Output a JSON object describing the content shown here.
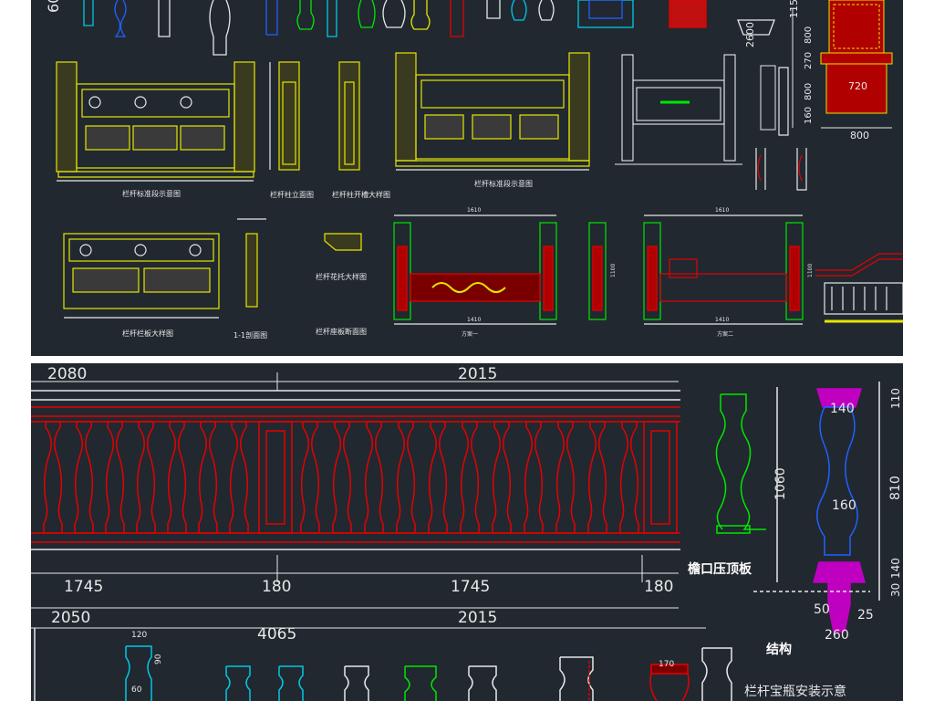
{
  "colors": {
    "background": "#212830",
    "page": "#ffffff",
    "yellow": "#e6e600",
    "red": "#e60000",
    "green": "#00e600",
    "cyan": "#00c8e6",
    "white": "#e8e8e8",
    "magenta": "#c000c0",
    "blue": "#2060ff"
  },
  "top_sheet": {
    "labels": {
      "standard_section": "栏杆标准段示意图",
      "post_elevation": "栏杆柱立面图",
      "post_groove": "栏杆柱开槽大样图",
      "panel_detail": "栏杆栏板大样图",
      "section_1_1": "1-1剖面图",
      "flower_bracket": "栏杆花托大样图",
      "base_section": "栏杆座板断面图",
      "standard_section_2": "栏杆标准段示意图",
      "scheme_1": "方案一",
      "scheme_2": "方案二"
    },
    "dims": {
      "d600": "600",
      "d2600": "2600",
      "d1150": "1150",
      "d800a": "800",
      "d270": "270",
      "d800b": "800",
      "d160": "160",
      "d720": "720",
      "d800c": "800",
      "d1610a": "1610",
      "d1610b": "1610",
      "d1410a": "1410",
      "d1410b": "1410",
      "d1100a": "1100",
      "d1100b": "1100"
    }
  },
  "bottom_sheet": {
    "dims": {
      "top_left": "2080",
      "top_right": "2015",
      "d1745a": "1745",
      "d180a": "180",
      "d1745b": "1745",
      "d180b": "180",
      "d2050": "2050",
      "d2015": "2015",
      "d4065": "4065",
      "d1060": "1060",
      "d140": "140",
      "d160": "160",
      "d810": "810",
      "d110": "110",
      "d30": "30",
      "d140b": "140",
      "d50": "50",
      "d25": "25",
      "d260": "260",
      "d120": "120",
      "d90": "90",
      "d60": "60",
      "d170": "170"
    },
    "labels": {
      "eave_cap": "檐口压顶板",
      "structure": "结构",
      "install_title": "栏杆宝瓶安装示意"
    }
  }
}
